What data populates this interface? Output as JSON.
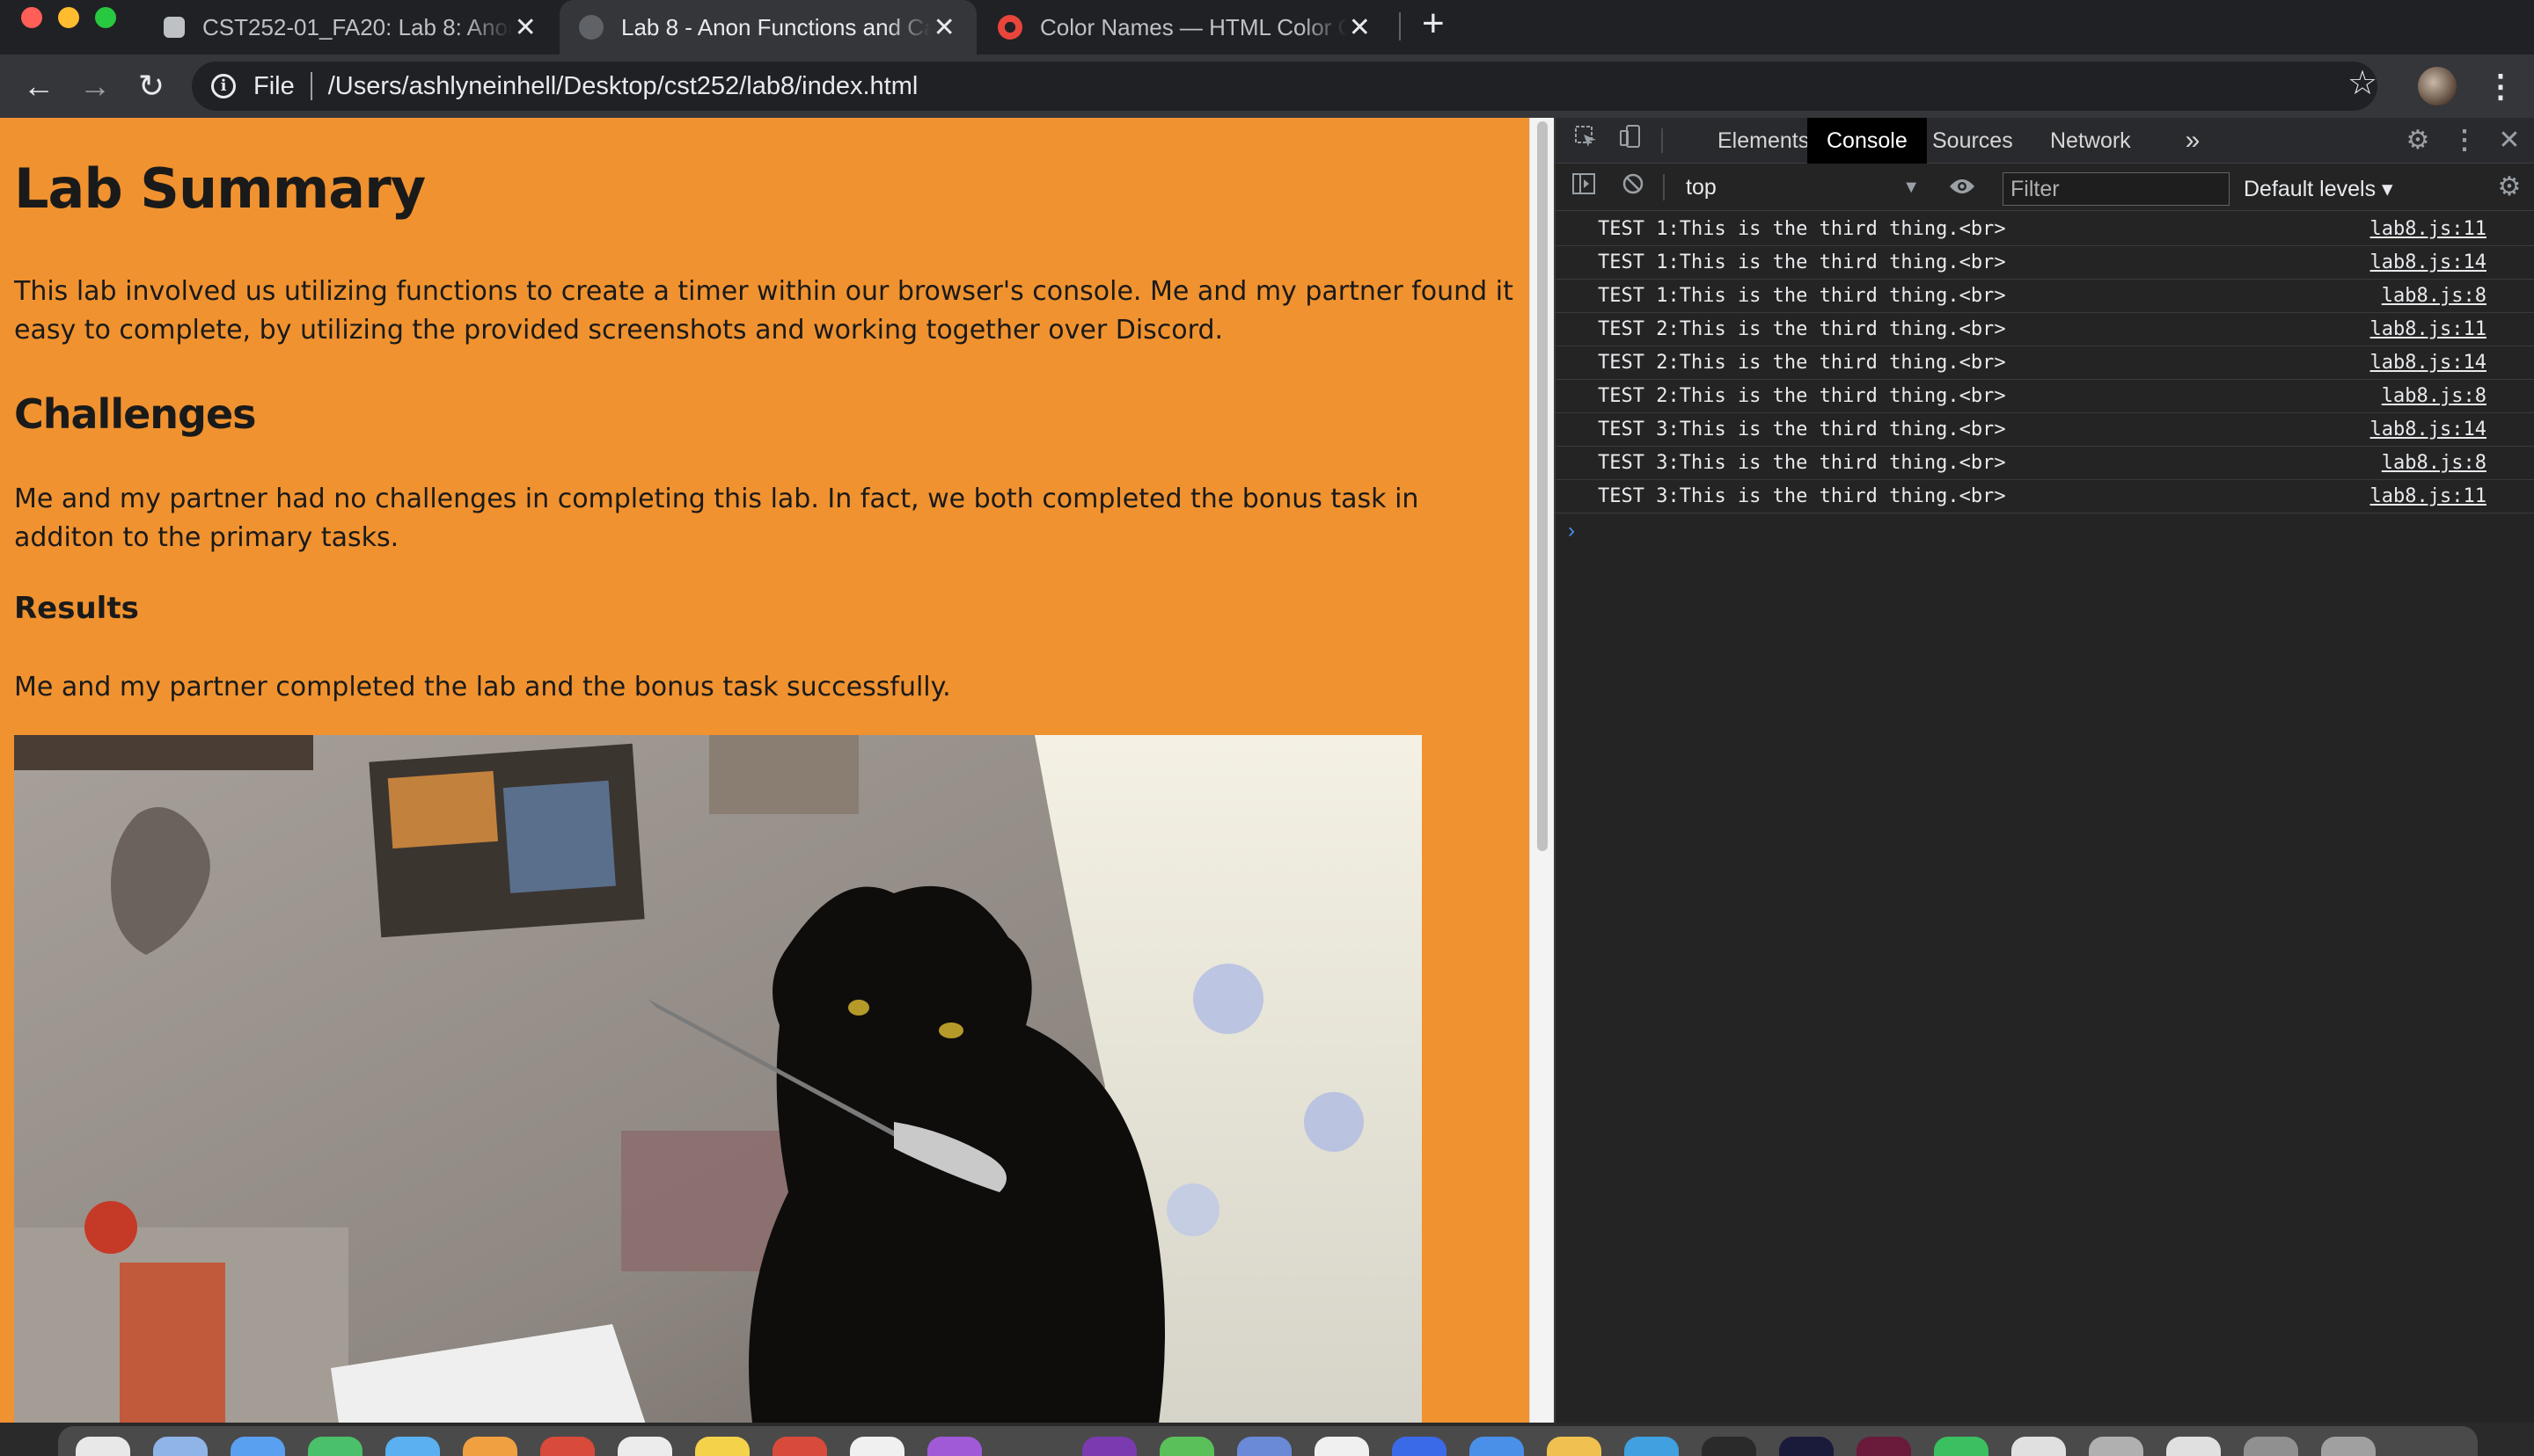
{
  "browser": {
    "tabs": [
      {
        "title": "CST252-01_FA20: Lab 8: Anon",
        "close": "✕",
        "active": false
      },
      {
        "title": "Lab 8 - Anon Functions and Ca",
        "close": "✕",
        "active": true
      },
      {
        "title": "Color Names — HTML Color Co",
        "close": "✕",
        "active": false
      }
    ],
    "new_tab": "+",
    "back": "←",
    "forward": "→",
    "reload": "↻",
    "info_icon": "i",
    "url_scheme": "File",
    "url": "/Users/ashlyneinhell/Desktop/cst252/lab8/index.html",
    "star": "☆",
    "menu": "⋮"
  },
  "page": {
    "title": "Lab Summary",
    "summary": "This lab involved us utilizing functions to create a timer within our browser's console. Me and my partner found it easy to complete, by utilizing the provided screenshots and working together over Discord.",
    "challenges_heading": "Challenges",
    "challenges_text": "Me and my partner had no challenges in completing this lab. In fact, we both completed the bonus task in additon to the primary tasks.",
    "results_heading": "Results",
    "results_text": "Me and my partner completed the lab and the bonus task successfully."
  },
  "devtools": {
    "tabs": [
      "Elements",
      "Console",
      "Sources",
      "Network"
    ],
    "active_tab": "Console",
    "more_tabs": "»",
    "context": "top",
    "filter_placeholder": "Filter",
    "levels": "Default levels ▾",
    "logs": [
      {
        "message": "TEST 1:This is the third thing.<br>",
        "source": "lab8.js:11"
      },
      {
        "message": "TEST 1:This is the third thing.<br>",
        "source": "lab8.js:14"
      },
      {
        "message": "TEST 1:This is the third thing.<br>",
        "source": "lab8.js:8"
      },
      {
        "message": "TEST 2:This is the third thing.<br>",
        "source": "lab8.js:11"
      },
      {
        "message": "TEST 2:This is the third thing.<br>",
        "source": "lab8.js:14"
      },
      {
        "message": "TEST 2:This is the third thing.<br>",
        "source": "lab8.js:8"
      },
      {
        "message": "TEST 3:This is the third thing.<br>",
        "source": "lab8.js:14"
      },
      {
        "message": "TEST 3:This is the third thing.<br>",
        "source": "lab8.js:8"
      },
      {
        "message": "TEST 3:This is the third thing.<br>",
        "source": "lab8.js:11"
      }
    ],
    "prompt": "›"
  },
  "colors": {
    "page_background": "#f0922f",
    "devtools_background": "#242424",
    "tab_strip": "#202124",
    "toolbar": "#35363a"
  }
}
